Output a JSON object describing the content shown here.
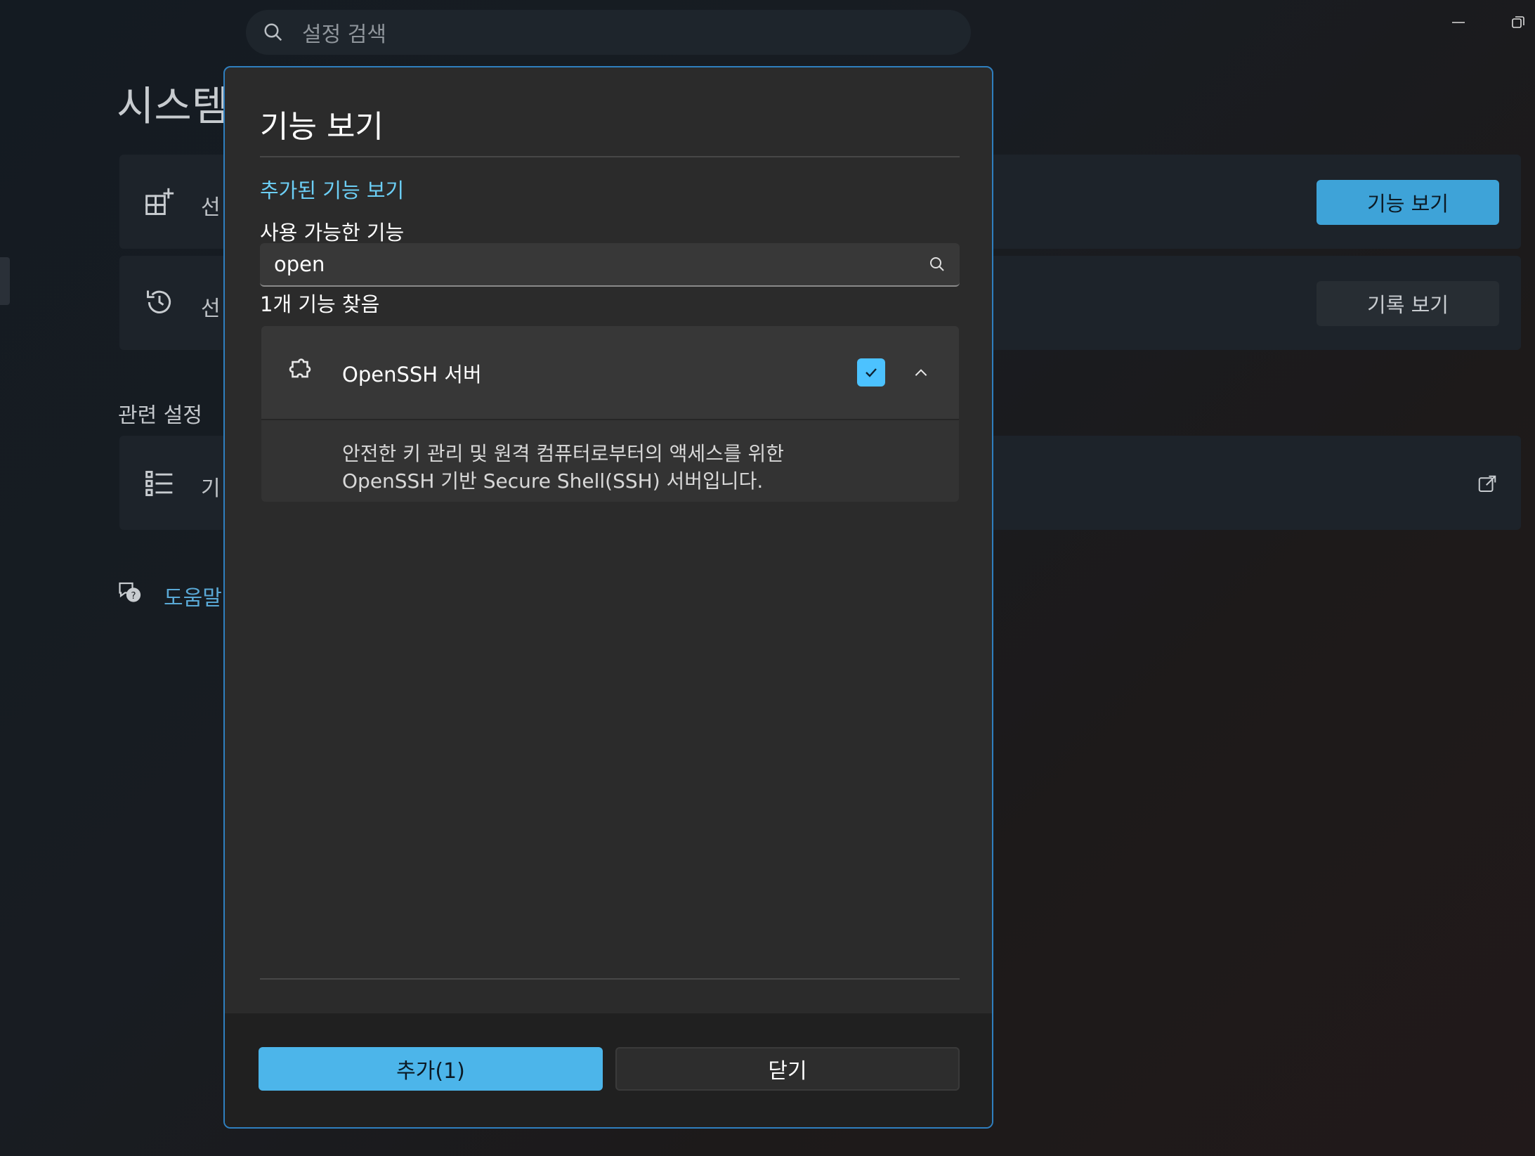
{
  "background": {
    "search": {
      "placeholder": "설정 검색"
    },
    "page_title": "시스템",
    "cards": [
      {
        "label": "선",
        "button": "기능 보기"
      },
      {
        "label": "선",
        "button": "기록 보기"
      }
    ],
    "related_settings": {
      "heading": "관련 설정",
      "item_label": "기"
    },
    "help_link": "도움말"
  },
  "dialog": {
    "title": "기능 보기",
    "added_features_link": "추가된 기능 보기",
    "available_label": "사용 가능한 기능",
    "filter": {
      "value": "open"
    },
    "found_count": "1개 기능 찾음",
    "features": [
      {
        "name": "OpenSSH 서버",
        "checked": true,
        "expanded": true,
        "description_line1": "안전한 키 관리 및 원격 컴퓨터로부터의 액세스를 위한",
        "description_line2": "OpenSSH 기반 Secure Shell(SSH) 서버입니다."
      }
    ],
    "add_button": "추가(1)",
    "close_button": "닫기"
  },
  "colors": {
    "accent": "#4cc2ff",
    "link": "#6ccff6",
    "dialog_border": "#2f7fbf"
  }
}
